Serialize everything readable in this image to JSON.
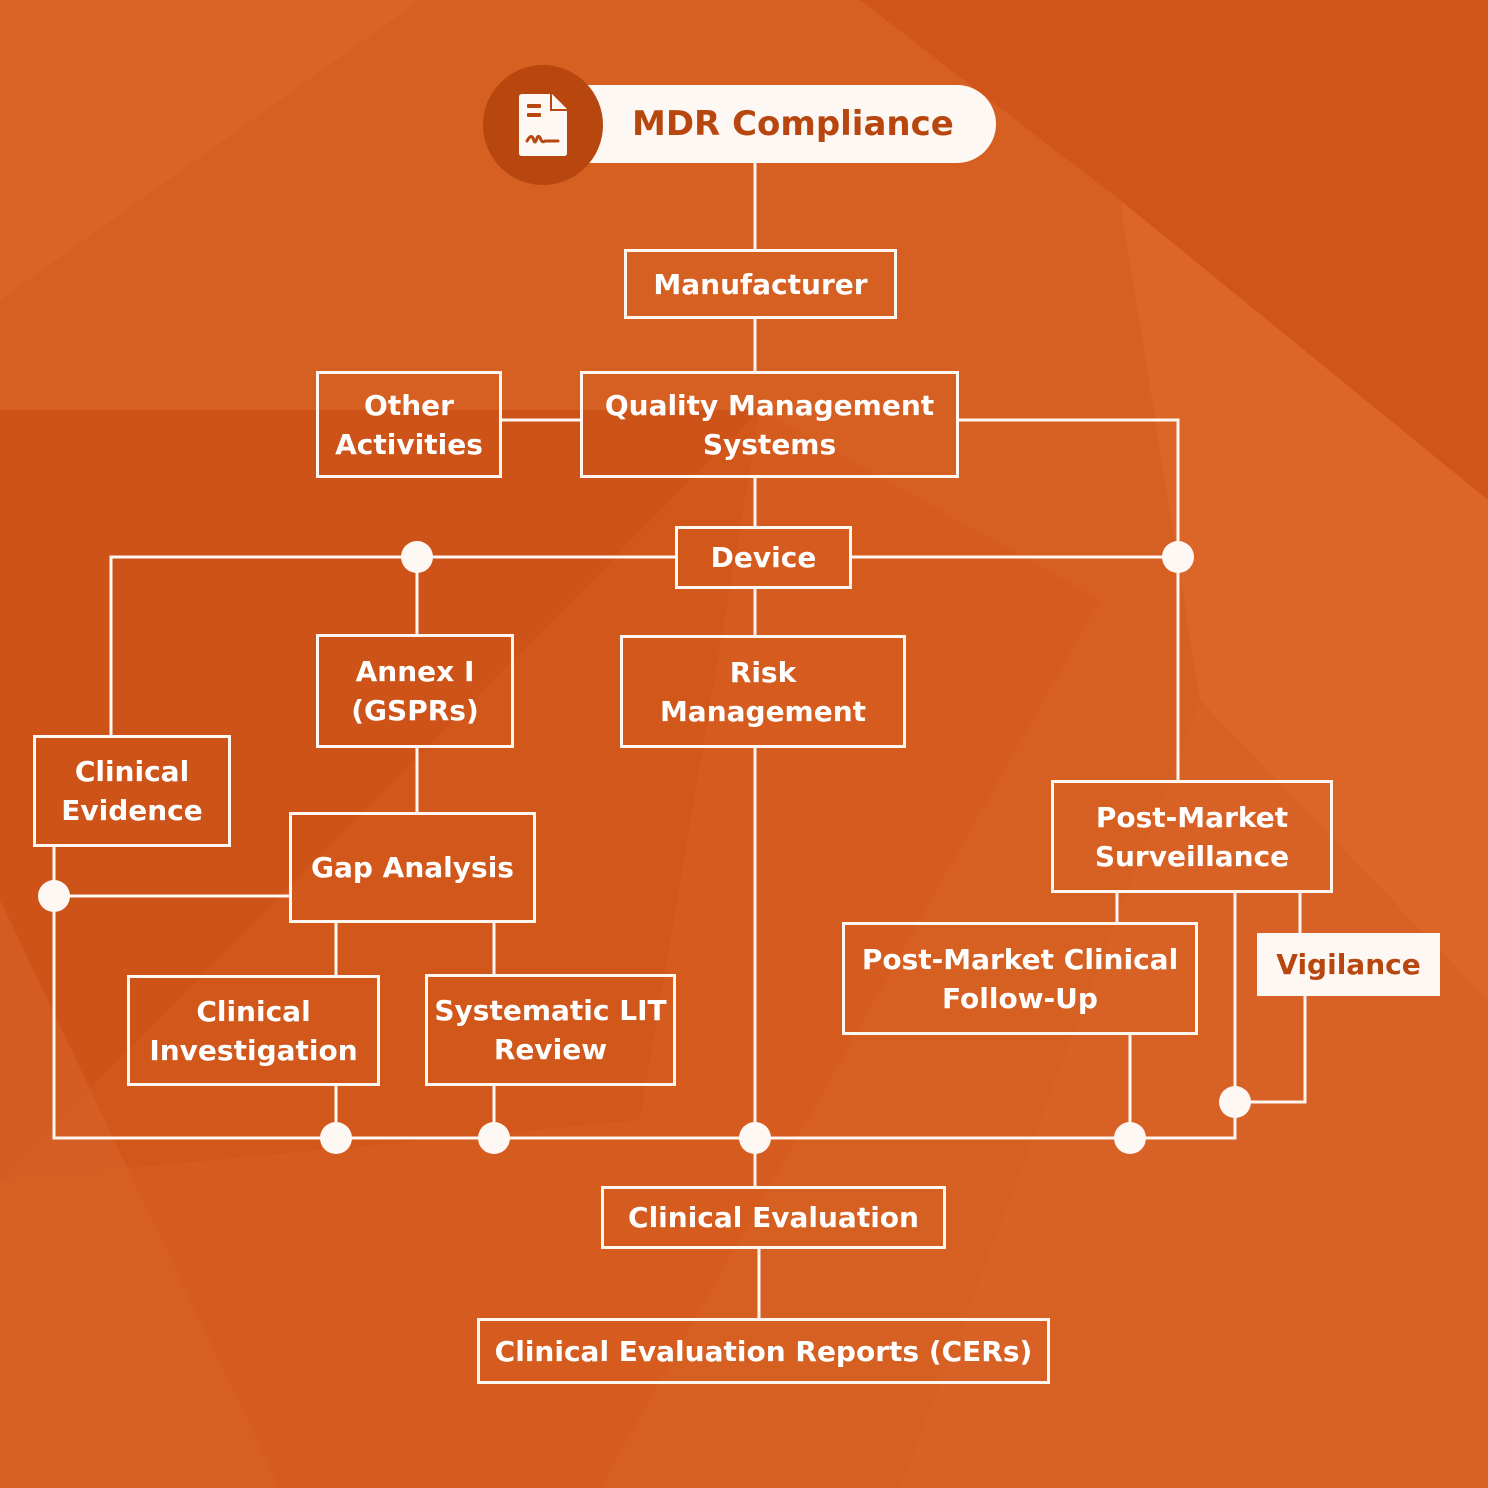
{
  "colors": {
    "background": "#d65f22",
    "background_dark": "#c9521a",
    "line": "#fdf6f1",
    "accent_dark": "#b8460f",
    "pill": "#fdf8f4"
  },
  "header": {
    "icon": "document-signature-icon",
    "title": "MDR Compliance"
  },
  "nodes": {
    "manufacturer": "Manufacturer",
    "other_activities": [
      "Other",
      "Activities"
    ],
    "qms": [
      "Quality Management",
      "Systems"
    ],
    "device": "Device",
    "annex": [
      "Annex I",
      "(GSPRs)"
    ],
    "risk_management": [
      "Risk",
      "Management"
    ],
    "clinical_evidence": [
      "Clinical",
      "Evidence"
    ],
    "gap_analysis": "Gap Analysis",
    "clinical_investigation": [
      "Clinical",
      "Investigation"
    ],
    "systematic_lit_review": [
      "Systematic LIT",
      "Review"
    ],
    "post_market_surveillance": [
      "Post-Market",
      "Surveillance"
    ],
    "pmcf": [
      "Post-Market Clinical",
      "Follow-Up"
    ],
    "vigilance": "Vigilance",
    "clinical_evaluation": "Clinical Evaluation",
    "cers": "Clinical Evaluation Reports (CERs)"
  }
}
